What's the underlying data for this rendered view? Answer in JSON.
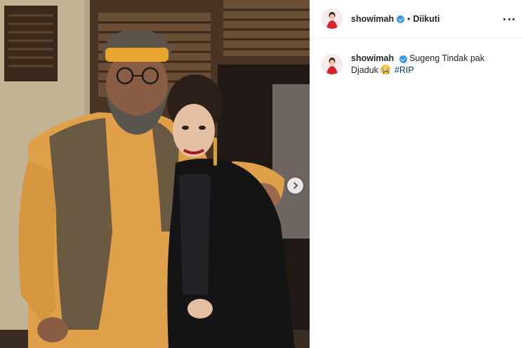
{
  "post": {
    "username": "showimah",
    "verified_icon": "verified-badge-icon",
    "separator": "•",
    "follow_status": "Diikuti",
    "more_icon": "more-horizontal-icon",
    "next_icon": "chevron-right-icon"
  },
  "caption": {
    "username": "showimah",
    "text": "Sugeng Tindak pak Djaduk",
    "emoji_icon": "crying-face-icon",
    "hashtag": "#RIP"
  },
  "colors": {
    "verified": "#3897f0",
    "hashtag": "#00376b",
    "divider": "#efefef"
  }
}
